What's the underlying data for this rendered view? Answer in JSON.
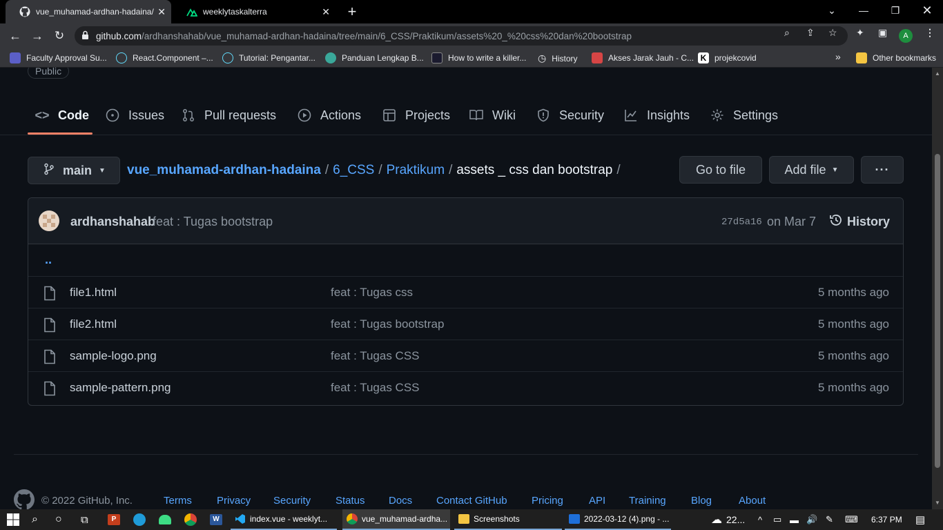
{
  "browser": {
    "tabs": [
      {
        "title": "vue_muhamad-ardhan-hadaina/",
        "active": true
      },
      {
        "title": "weeklytaskalterra",
        "active": false
      }
    ],
    "new_tab": "+",
    "url_host": "github.com",
    "url_path": "/ardhanshahab/vue_muhamad-ardhan-hadaina/tree/main/6_CSS/Praktikum/assets%20_%20css%20dan%20bootstrap",
    "profile_initial": "A",
    "bookmarks": [
      {
        "label": "Faculty Approval Su...",
        "color": "#5b5fc7"
      },
      {
        "label": "React.Component –...",
        "color": "#61dafb"
      },
      {
        "label": "Tutorial: Pengantar...",
        "color": "#61dafb"
      },
      {
        "label": "Panduan Lengkap B...",
        "color": "#3aa89a"
      },
      {
        "label": "How to write a killer...",
        "color": "#1a1a2e"
      },
      {
        "label": "History",
        "color": "#35363a"
      },
      {
        "label": "Akses Jarak Jauh - C...",
        "color": "#d64545"
      },
      {
        "label": "projekcovid",
        "color": "#ffffff"
      }
    ],
    "bookmarks_more": "»",
    "other_bookmarks": "Other bookmarks"
  },
  "repo": {
    "visibility": "Public",
    "nav": [
      {
        "label": "Code",
        "icon": "code-icon"
      },
      {
        "label": "Issues",
        "icon": "issue-icon"
      },
      {
        "label": "Pull requests",
        "icon": "pull-request-icon"
      },
      {
        "label": "Actions",
        "icon": "play-icon"
      },
      {
        "label": "Projects",
        "icon": "table-icon"
      },
      {
        "label": "Wiki",
        "icon": "book-icon"
      },
      {
        "label": "Security",
        "icon": "shield-icon"
      },
      {
        "label": "Insights",
        "icon": "graph-icon"
      },
      {
        "label": "Settings",
        "icon": "gear-icon"
      }
    ],
    "branch": "main",
    "breadcrumb": {
      "repo": "vue_muhamad-ardhan-hadaina",
      "dir1": "6_CSS",
      "dir2": "Praktikum",
      "current": "assets _ css dan bootstrap",
      "sep": "/"
    },
    "go_to_file": "Go to file",
    "add_file": "Add file",
    "more": "···",
    "commit": {
      "author": "ardhanshahab",
      "message": "feat : Tugas bootstrap",
      "sha": "27d5a16",
      "date": "on Mar 7",
      "history": "History"
    },
    "parent_dir": "..",
    "files": [
      {
        "name": "file1.html",
        "message": "feat : Tugas css",
        "age": "5 months ago"
      },
      {
        "name": "file2.html",
        "message": "feat : Tugas bootstrap",
        "age": "5 months ago"
      },
      {
        "name": "sample-logo.png",
        "message": "feat : Tugas CSS",
        "age": "5 months ago"
      },
      {
        "name": "sample-pattern.png",
        "message": "feat : Tugas CSS",
        "age": "5 months ago"
      }
    ]
  },
  "footer": {
    "copyright": "© 2022 GitHub, Inc.",
    "links": [
      "Terms",
      "Privacy",
      "Security",
      "Status",
      "Docs",
      "Contact GitHub",
      "Pricing",
      "API",
      "Training",
      "Blog",
      "About"
    ]
  },
  "taskbar": {
    "apps": [
      {
        "label": "index.vue - weeklyt...",
        "active": false
      },
      {
        "label": "vue_muhamad-ardha...",
        "active": true
      },
      {
        "label": "Screenshots",
        "active": false
      },
      {
        "label": "2022-03-12 (4).png - ...",
        "active": false
      }
    ],
    "weather": "22...",
    "time": "6:37 PM"
  }
}
